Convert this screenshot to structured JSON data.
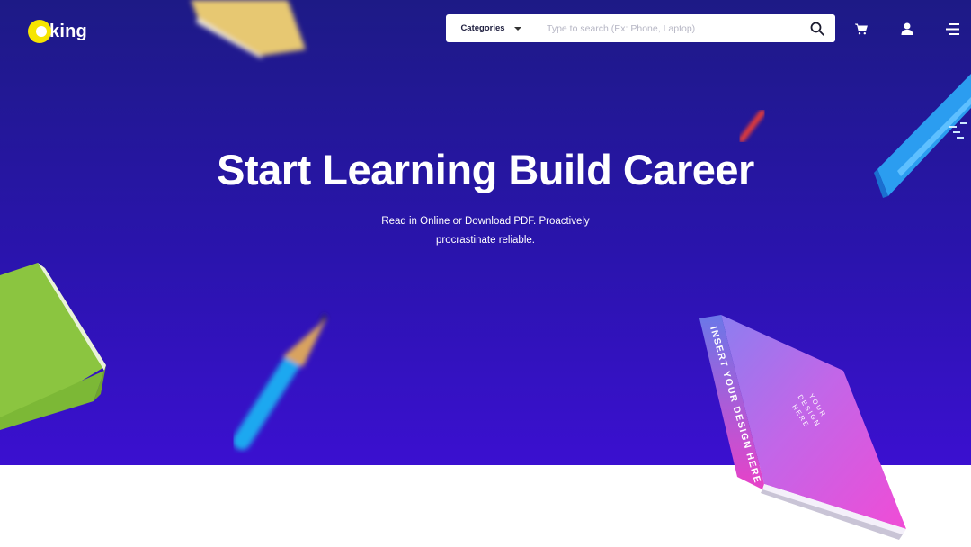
{
  "brand": {
    "name": "king"
  },
  "search": {
    "category_label": "Categories",
    "placeholder": "Type to search (Ex: Phone, Laptop)"
  },
  "header_icons": [
    "search-icon",
    "cart-icon",
    "user-icon",
    "menu-icon"
  ],
  "hero": {
    "title": "Start Learning Build Career",
    "subtitle_line1": "Read in Online or Download PDF. Proactively",
    "subtitle_line2": "procrastinate reliable."
  },
  "book_cover": {
    "spine_text": "INSERT YOUR DESIGN HERE",
    "cover_text_1": "YOUR",
    "cover_text_2": "DESIGN",
    "cover_text_3": "HERE"
  },
  "colors": {
    "hero_top": "#1d1a86",
    "hero_bottom": "#3b10d0",
    "logo_yellow": "#f6e500",
    "text": "#ffffff"
  }
}
